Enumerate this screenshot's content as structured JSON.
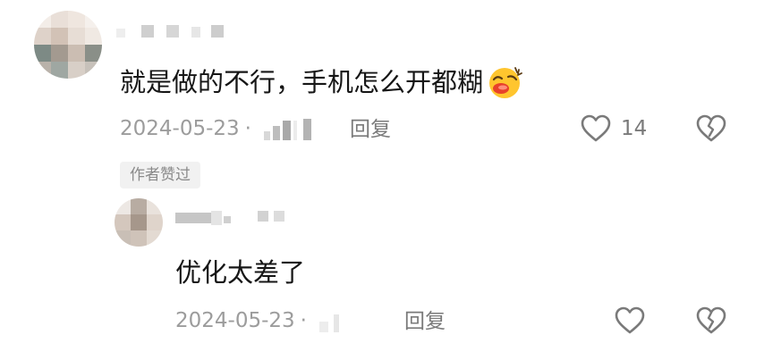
{
  "colors": {
    "text": "#161616",
    "meta": "#9c9c9c",
    "icon": "#7a7a7a",
    "badge_bg": "#f1f1f1"
  },
  "comment": {
    "text": "就是做的不行，手机怎么开都糊",
    "emoji_icon": "laughing-face-emoji",
    "date": "2024-05-23",
    "date_separator": "·",
    "reply_label": "回复",
    "like_count": "14",
    "author_badge": "作者赞过"
  },
  "reply": {
    "text": "优化太差了",
    "date": "2024-05-23",
    "date_separator": "·",
    "reply_label": "回复"
  }
}
